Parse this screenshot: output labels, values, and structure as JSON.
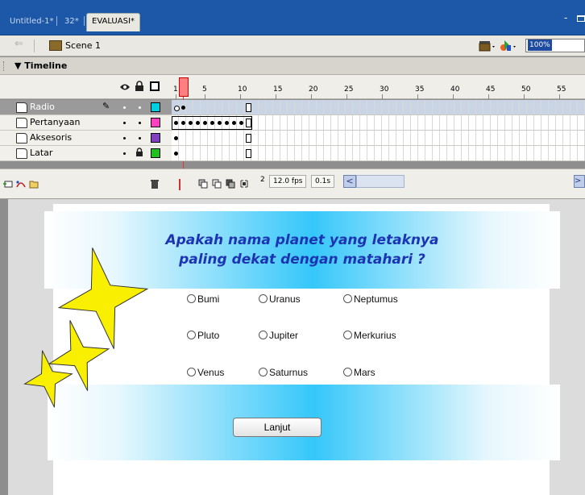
{
  "tabs": [
    {
      "label": "Untitled-1*",
      "active": false
    },
    {
      "label": "32*",
      "active": false
    },
    {
      "label": "EVALUASI*",
      "active": true
    }
  ],
  "window_controls": {
    "minimize": "-",
    "maximize": "□"
  },
  "scene_bar": {
    "scene_label": "Scene 1",
    "zoom": "100%"
  },
  "timeline": {
    "title": "Timeline",
    "ruler_labels": [
      "1",
      "5",
      "10",
      "15",
      "20",
      "25",
      "30",
      "35",
      "40",
      "45",
      "50",
      "55"
    ],
    "layers": [
      {
        "name": "Radio",
        "selected": true,
        "editing": true,
        "locked": false,
        "color": "#00d0e0"
      },
      {
        "name": "Pertanyaan",
        "selected": false,
        "editing": false,
        "locked": false,
        "color": "#ff40c0"
      },
      {
        "name": "Aksesoris",
        "selected": false,
        "editing": false,
        "locked": false,
        "color": "#8040c0"
      },
      {
        "name": "Latar",
        "selected": false,
        "editing": false,
        "locked": true,
        "color": "#20c020"
      }
    ],
    "current_frame": "2",
    "frame_rate": "12.0 fps",
    "elapsed_time": "0.1s"
  },
  "stage": {
    "question_line1": "Apakah nama planet yang letaknya",
    "question_line2": "paling dekat dengan matahari ?",
    "options": [
      "Bumi",
      "Uranus",
      "Neptumus",
      "Pluto",
      "Jupiter",
      "Merkurius",
      "Venus",
      "Saturnus",
      "Mars"
    ],
    "next_label": "Lanjut",
    "colors": {
      "question": "#1c33b2",
      "banner": "#35c7fa",
      "star": "#f8f000"
    }
  }
}
